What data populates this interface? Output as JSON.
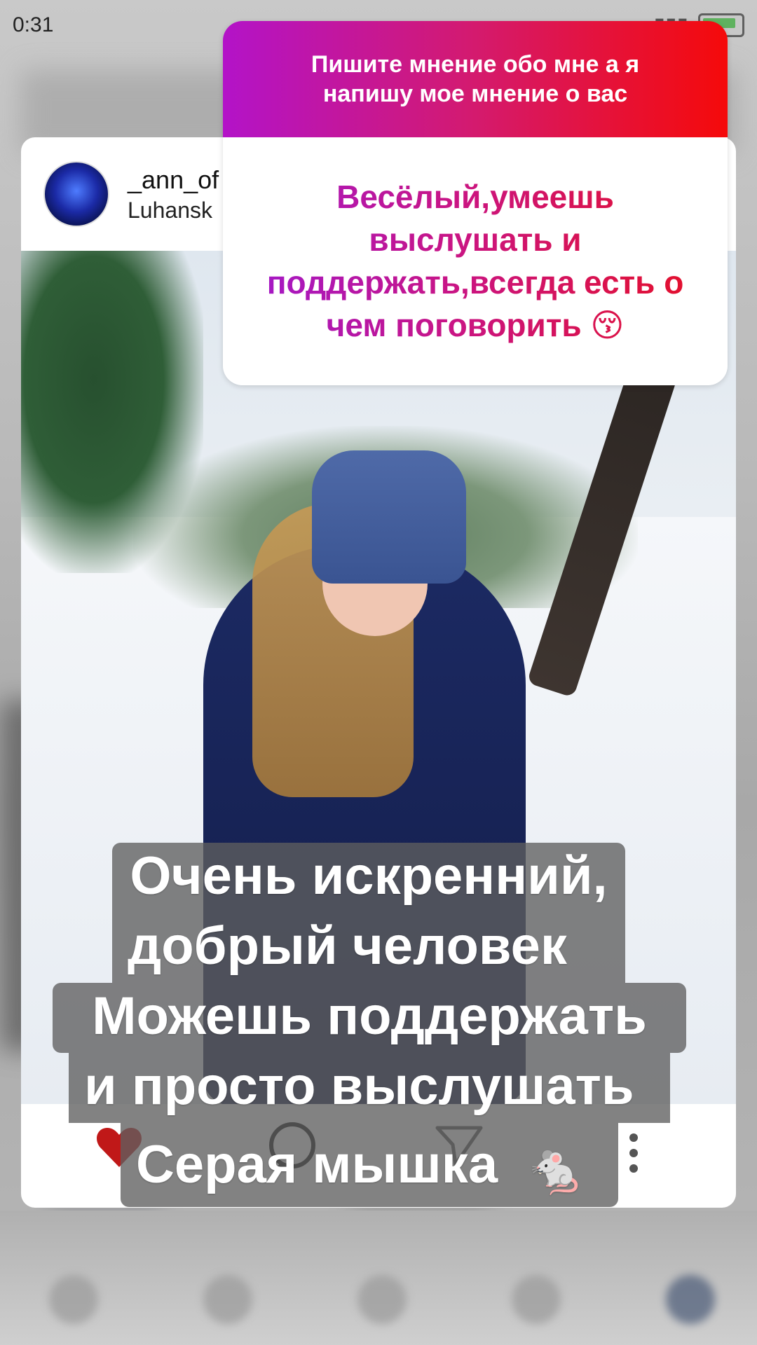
{
  "status_bar": {
    "time": "0:31"
  },
  "question_sticker": {
    "prompt": "Пишите мнение обо мне а я напишу мое мнение о вас",
    "answer": "Весёлый,умеешь выслушать и поддержать,всегда есть о чем поговорить 😚"
  },
  "post": {
    "username": "_ann_of",
    "location": "Luhansk"
  },
  "caption": {
    "line1": "Очень искренний,",
    "line2": "добрый  человек",
    "line3": "Можешь поддержать",
    "line4": "и просто выслушать",
    "line5": "Серая мышка",
    "emoji": "🐁"
  },
  "colors": {
    "sticker_gradient_start": "#b313c8",
    "sticker_gradient_end": "#f50a0a",
    "caption_bg": "#5f5f5f"
  },
  "icons": [
    "heart-icon",
    "comment-icon",
    "share-icon",
    "more-icon",
    "battery-icon"
  ]
}
